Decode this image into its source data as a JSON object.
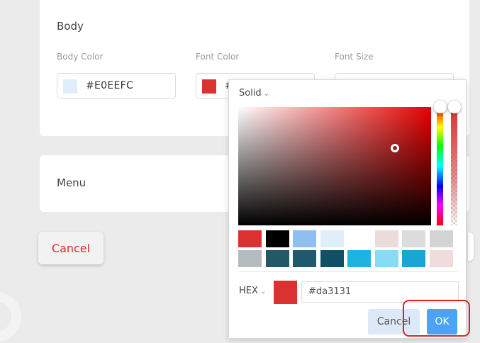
{
  "body_section": {
    "title": "Body",
    "body_color": {
      "label": "Body Color",
      "value": "#E0EEFC",
      "swatch": "#e0eefc"
    },
    "font_color": {
      "label": "Font Color",
      "value": "#",
      "swatch": "#da3131"
    },
    "font_size": {
      "label": "Font Size",
      "value": ""
    }
  },
  "menu_section": {
    "title": "Menu"
  },
  "footer": {
    "cancel_label": "Cancel"
  },
  "picker": {
    "mode": "Solid",
    "mode_chevron": "⌄",
    "hue_color": "#e80000",
    "selected_color": "#da3131",
    "presets": [
      "#da3131",
      "#000000",
      "#8fbff0",
      "#e0eefc",
      "#ffffff",
      "#ecdcdc",
      "#dcdcdc",
      "#d4d4d4",
      "#b4bcc0",
      "#235866",
      "#1e5a6e",
      "#0f5166",
      "#1fb4e0",
      "#86dcf5",
      "#1aa6d4",
      "#f0dcdc"
    ],
    "hex_label": "HEX",
    "hex_value": "#da3131",
    "cancel_label": "Cancel",
    "ok_label": "OK"
  },
  "colors": {
    "accent": "#4aa3f5",
    "danger": "#d9302f",
    "highlight": "#e02020"
  }
}
